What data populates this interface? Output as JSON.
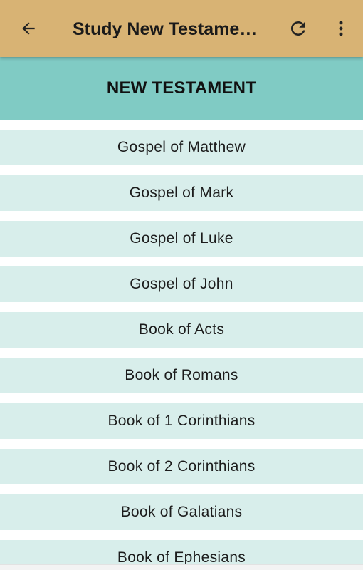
{
  "toolbar": {
    "title": "Study New Testame…",
    "background_color": "#d8b374",
    "back_icon": "arrow-left-icon",
    "refresh_icon": "refresh-icon",
    "menu_icon": "more-vertical-icon"
  },
  "section": {
    "title": "NEW TESTAMENT",
    "background_color": "#80cbc4"
  },
  "list": {
    "item_background_color": "#d8eeeb",
    "items": [
      "Gospel of Matthew",
      "Gospel of Mark",
      "Gospel of Luke",
      "Gospel of John",
      "Book of Acts",
      "Book of Romans",
      "Book of 1 Corinthians",
      "Book of 2 Corinthians",
      "Book of Galatians",
      "Book of Ephesians"
    ]
  }
}
